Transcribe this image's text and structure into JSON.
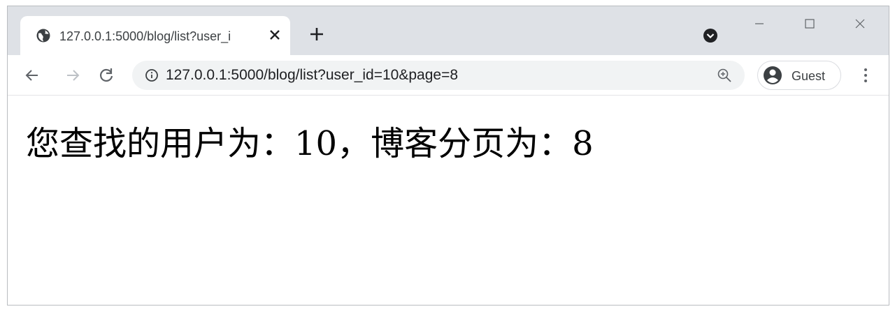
{
  "tab": {
    "title": "127.0.0.1:5000/blog/list?user_i",
    "favicon": "globe-icon",
    "close": "close-icon"
  },
  "new_tab": "plus-icon",
  "window_controls": [
    "minimize-icon",
    "maximize-icon",
    "close-icon"
  ],
  "toolbar": {
    "back": "arrow-left-icon",
    "forward": "arrow-right-icon",
    "reload": "reload-icon",
    "site_info": "info-icon",
    "url": "127.0.0.1:5000/blog/list?user_id=10&page=8",
    "zoom": "zoom-in-icon",
    "profile_label": "Guest",
    "menu": "more-vertical-icon"
  },
  "page": {
    "text": "您查找的用户为：10，博客分页为：8"
  },
  "colors": {
    "tabstrip": "#dee1e6",
    "omnibox": "#f1f3f4",
    "icon": "#5f6368",
    "text": "#000000"
  }
}
